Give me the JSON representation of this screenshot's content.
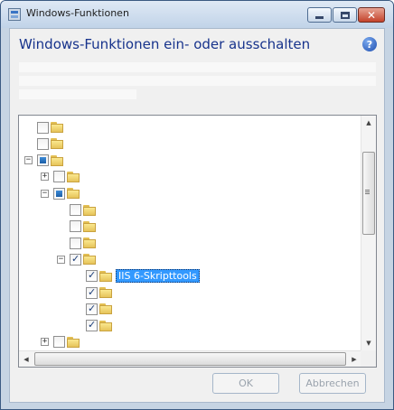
{
  "window": {
    "title": "Windows-Funktionen",
    "close_glyph": "✕",
    "min_icon": "minimize-icon",
    "max_icon": "maximize-icon",
    "close_icon": "close-icon"
  },
  "header": {
    "title": "Windows-Funktionen ein- oder ausschalten",
    "help_glyph": "?"
  },
  "tree": {
    "selected_label": "IIS 6-Skripttools",
    "expander_plus": "+",
    "expander_minus": "−",
    "items": [
      {
        "level": 0,
        "expander": "none",
        "state": "unchecked"
      },
      {
        "level": 0,
        "expander": "none",
        "state": "unchecked"
      },
      {
        "level": 0,
        "expander": "minus",
        "state": "partial"
      },
      {
        "level": 1,
        "expander": "plus",
        "state": "unchecked"
      },
      {
        "level": 1,
        "expander": "minus",
        "state": "partial"
      },
      {
        "level": 2,
        "expander": "none",
        "state": "unchecked"
      },
      {
        "level": 2,
        "expander": "none",
        "state": "unchecked"
      },
      {
        "level": 2,
        "expander": "none",
        "state": "unchecked"
      },
      {
        "level": 2,
        "expander": "minus",
        "state": "checked"
      },
      {
        "level": 3,
        "expander": "none",
        "state": "checked",
        "selected": true
      },
      {
        "level": 3,
        "expander": "none",
        "state": "checked"
      },
      {
        "level": 3,
        "expander": "none",
        "state": "checked"
      },
      {
        "level": 3,
        "expander": "none",
        "state": "checked"
      },
      {
        "level": 1,
        "expander": "plus",
        "state": "unchecked"
      },
      {
        "level": 0,
        "expander": "minus",
        "state": "partial"
      }
    ]
  },
  "buttons": {
    "ok": "OK",
    "cancel": "Abbrechen"
  }
}
